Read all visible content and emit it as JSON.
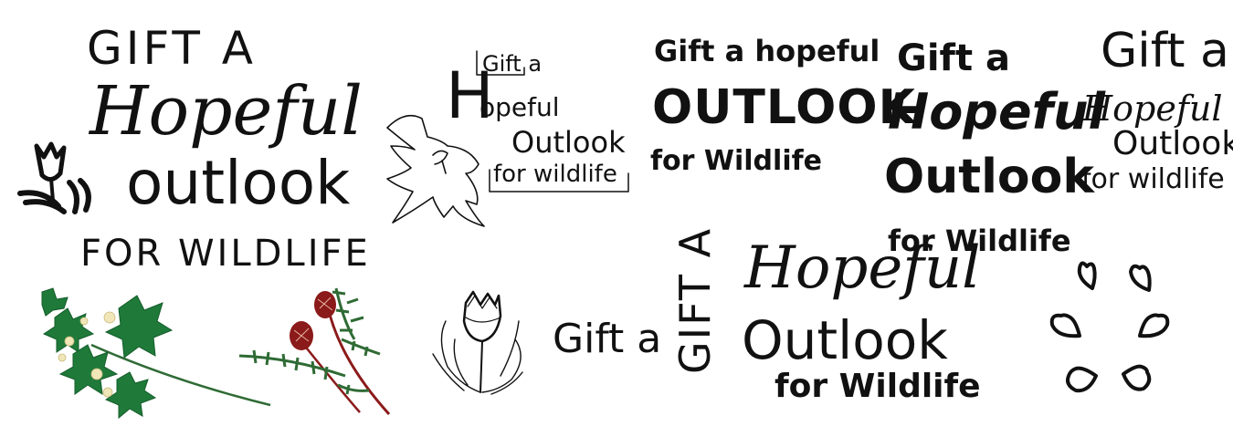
{
  "sketches": {
    "s1": {
      "l1": "GIFT A",
      "l2": "Hopeful",
      "l3": "outlook",
      "l4": "FOR WILDLIFE"
    },
    "s2": {
      "l1": "Gift a",
      "l2": "H",
      "l3": "opeful",
      "l4": "Outlook",
      "l5": "for wildlife"
    },
    "s3": {
      "l1": "Gift a hopeful",
      "l2": "OUTLOOK",
      "l3": "for Wildlife"
    },
    "s4": {
      "l1": "Gift a",
      "l2": "Hopeful",
      "l3": "Outlook",
      "l4": "for Wildlife"
    },
    "s5": {
      "l1": "Gift a",
      "l2": "Hopeful",
      "l3": "Outlook",
      "l4": "for wildlife"
    },
    "s6": {
      "l1": "Gift a"
    },
    "s7": {
      "l1": "GIFT A",
      "l2": "Hopeful",
      "l3": "Outlook",
      "l4": "for Wildlife"
    }
  },
  "colors": {
    "ink": "#111111",
    "leaf": "#1f7a3a",
    "leaf_dark": "#145c2a",
    "flower_cream": "#f0e6b8",
    "berry": "#8b1a1a",
    "stem": "#2f6b35"
  },
  "icons": [
    "tulip-icon",
    "leaf-outline-icon",
    "tulip-sketch-icon",
    "heart-ring-icon",
    "green-leaf-branch-icon",
    "red-flower-branch-icon"
  ]
}
